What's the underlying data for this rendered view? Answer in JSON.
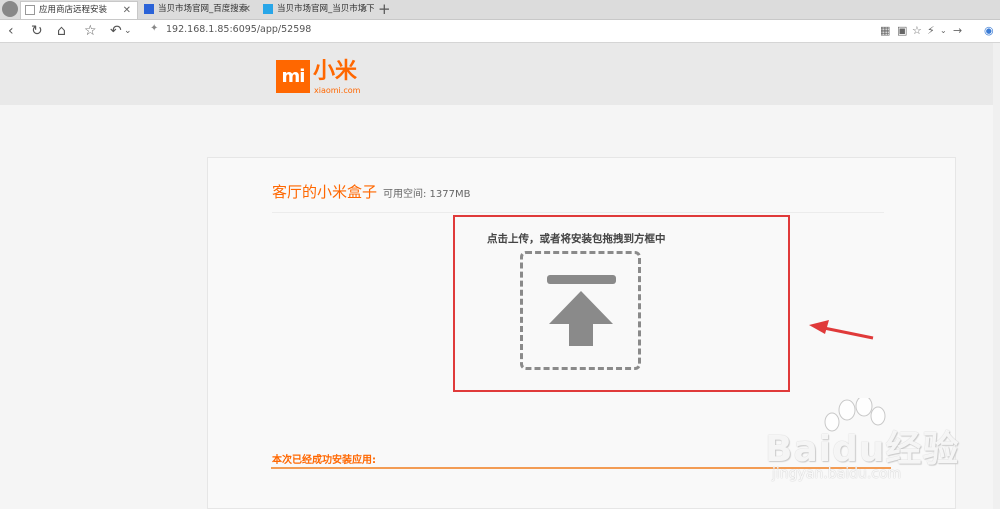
{
  "tabs": [
    {
      "title": "应用商店远程安装",
      "active": true
    },
    {
      "title": "当贝市场官网_百度搜索",
      "active": false
    },
    {
      "title": "当贝市场官网_当贝市场下",
      "active": false
    }
  ],
  "close_glyph": "✕",
  "new_tab_glyph": "+",
  "address": {
    "url": "192.168.1.85:6095/app/52598"
  },
  "nav_icons": [
    "back-icon",
    "reload-icon",
    "home-icon",
    "star-icon",
    "undo-icon"
  ],
  "right_icons": [
    "qr-icon",
    "translate-icon",
    "star-icon",
    "lightning-icon",
    "forward-icon",
    "menu-icon"
  ],
  "logo": {
    "mark": "mi",
    "cn": "小米",
    "en": "xiaomi.com",
    "color": "#ff6700"
  },
  "device": {
    "name": "客厅的小米盒子",
    "space_label": "可用空间: 1377MB"
  },
  "upload": {
    "hint": "点击上传，或者将安装包拖拽到方框中"
  },
  "status": {
    "success": "本次已经成功安装应用:",
    "progress": 1.0
  },
  "annotation": {
    "box_color": "#e03a3a"
  },
  "watermark": {
    "text": "Baidu经验",
    "sub": "jingyan.baidu.com"
  }
}
